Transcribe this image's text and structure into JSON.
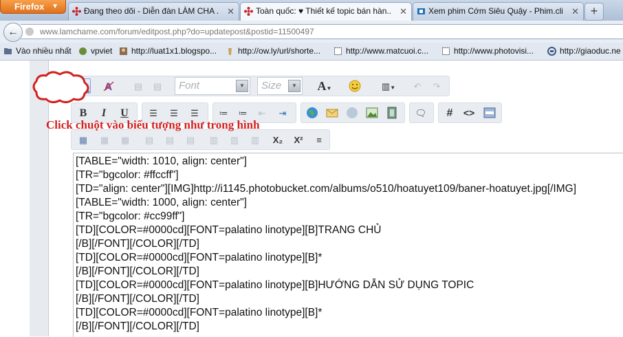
{
  "browser": {
    "menu_label": "Firefox",
    "tabs": [
      {
        "title": "Đang theo dõi - Diễn đàn LÀM CHA ...",
        "active": false
      },
      {
        "title": "Toàn quốc: ♥ Thiết kế topic bán hàn...",
        "active": true
      },
      {
        "title": "Xem phim Cớm Siêu Quậy - Phim.cli...",
        "active": false
      }
    ],
    "new_tab_label": "+",
    "url": "www.lamchame.com/forum/editpost.php?do=updatepost&postid=11500497",
    "bookmarks": [
      "Vào nhiều nhất",
      "vpviet",
      "http://luat1x1.blogspo...",
      "http://ow.ly/url/shorte...",
      "http://www.matcuoi.c...",
      "http://www.photovisi...",
      "http://giaoduc.ne"
    ]
  },
  "toolbar": {
    "font_placeholder": "Font",
    "size_placeholder": "Size",
    "bold": "B",
    "italic": "I",
    "underline": "U",
    "hash": "#",
    "code": "<>",
    "subscript": "X₂",
    "superscript": "X²"
  },
  "hint_text": "Click chuột vào biểu tượng như trong hình",
  "editor": {
    "lines": [
      "[TABLE=\"width: 1010, align: center\"]",
      "[TR=\"bgcolor: #ffccff\"]",
      "[TD=\"align: center\"][IMG]http://i1145.photobucket.com/albums/o510/hoatuyet109/baner-hoatuyet.jpg[/IMG]",
      "[TABLE=\"width: 1000, align: center\"]",
      "[TR=\"bgcolor: #cc99ff\"]",
      "[TD][COLOR=#0000cd][FONT=palatino linotype][B]TRANG CHỦ",
      "[/B][/FONT][/COLOR][/TD]",
      "[TD][COLOR=#0000cd][FONT=palatino linotype][B]*",
      "[/B][/FONT][/COLOR][/TD]",
      "[TD][COLOR=#0000cd][FONT=palatino linotype][B]HƯỚNG DẪN SỬ DỤNG TOPIC",
      "[/B][/FONT][/COLOR][/TD]",
      "[TD][COLOR=#0000cd][FONT=palatino linotype][B]*",
      "[/B][/FONT][/COLOR][/TD]"
    ]
  },
  "colors": {
    "hint": "#d2201f",
    "firefox_button": "#e8791f"
  }
}
